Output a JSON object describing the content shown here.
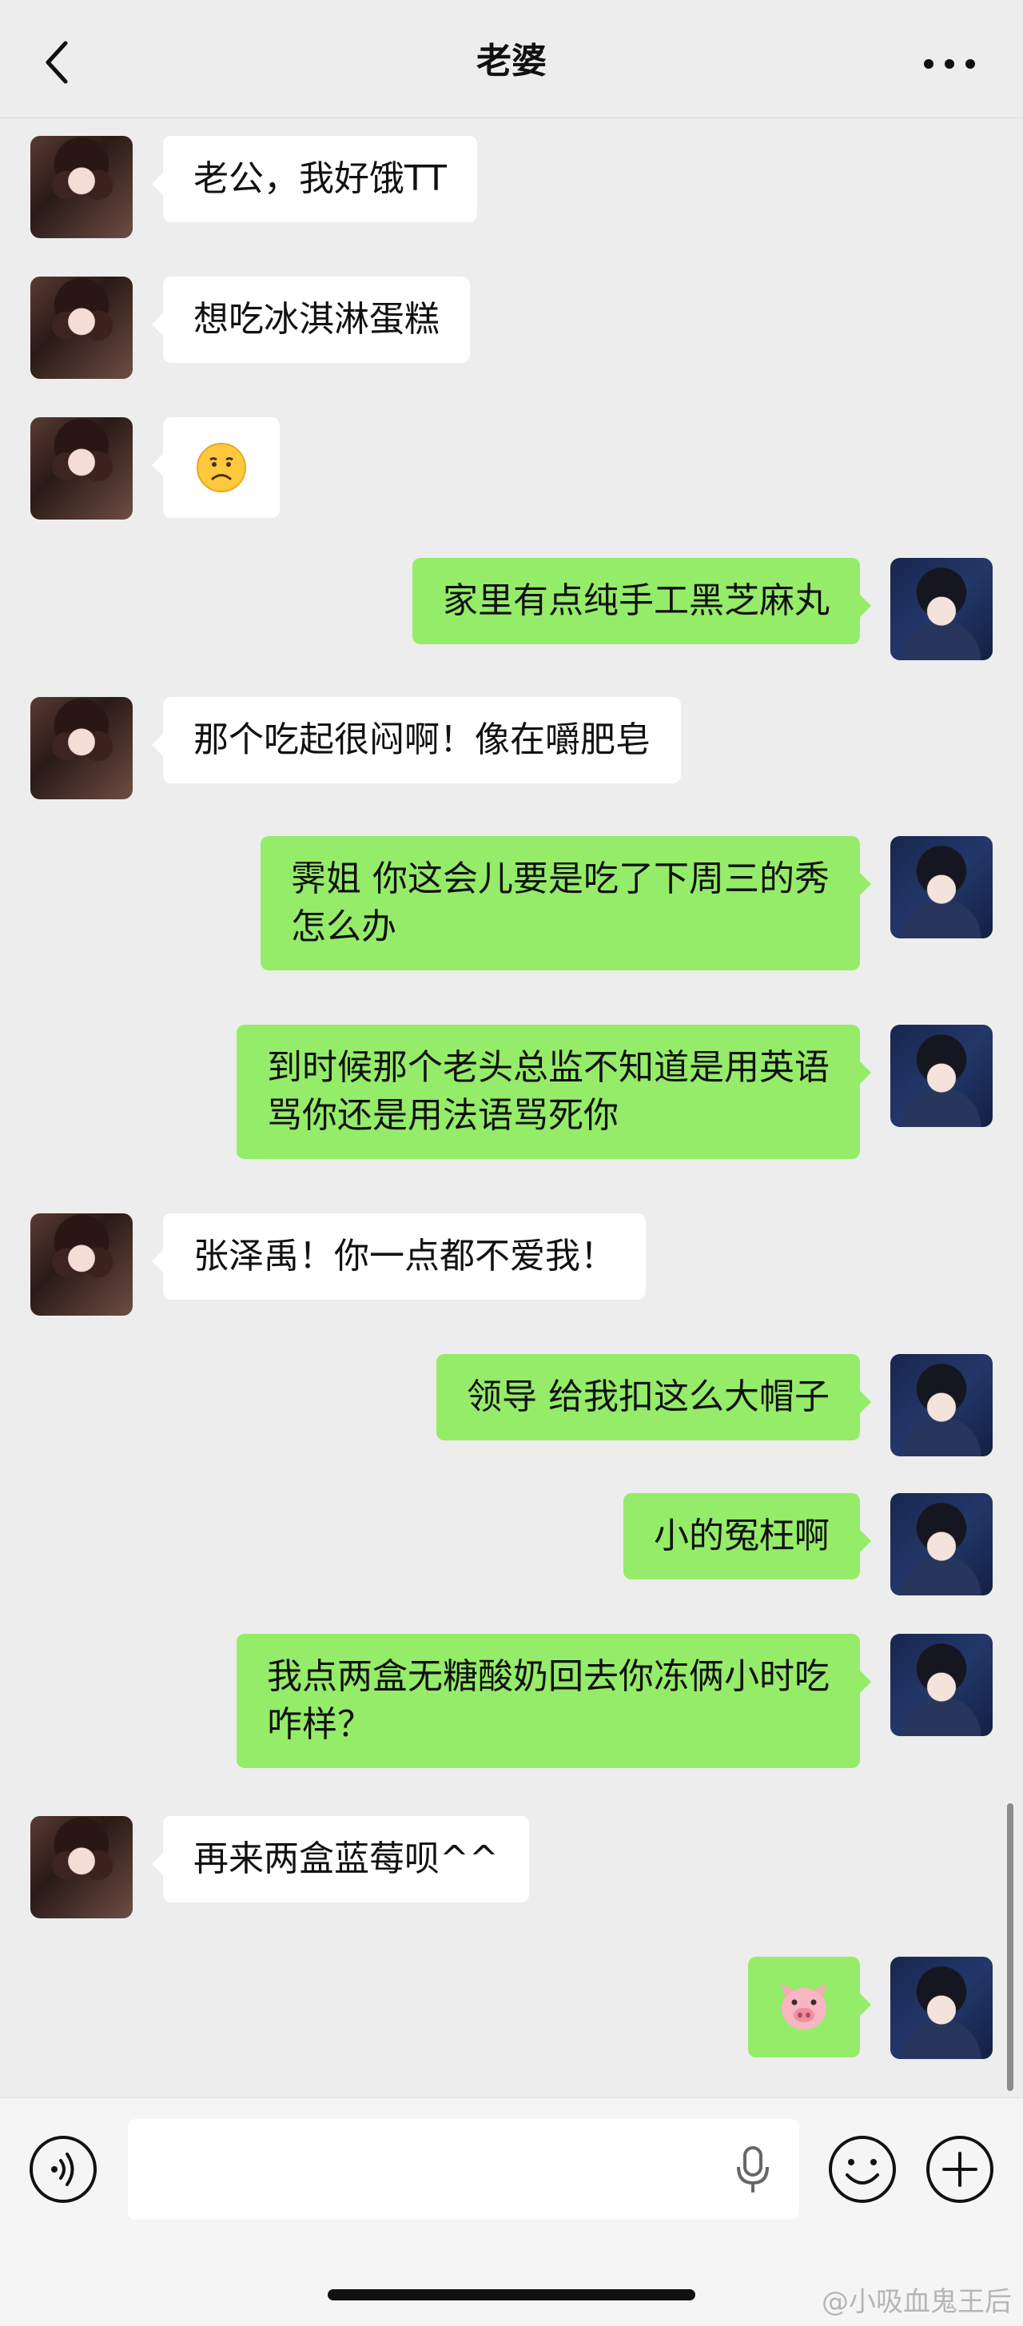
{
  "header": {
    "title": "老婆"
  },
  "messages": [
    {
      "side": "left",
      "text": "老公，我好饿TT"
    },
    {
      "side": "left",
      "text": "想吃冰淇淋蛋糕"
    },
    {
      "side": "left",
      "emoji": "sad-face"
    },
    {
      "side": "right",
      "text": "家里有点纯手工黑芝麻丸"
    },
    {
      "side": "left",
      "text": "那个吃起很闷啊！像在嚼肥皂"
    },
    {
      "side": "right",
      "text": "霁姐 你这会儿要是吃了下周三的秀\n怎么办"
    },
    {
      "side": "right",
      "text": "到时候那个老头总监不知道是用英语\n骂你还是用法语骂死你"
    },
    {
      "side": "left",
      "text": "张泽禹！你一点都不爱我！"
    },
    {
      "side": "right",
      "text": "领导 给我扣这么大帽子"
    },
    {
      "side": "right",
      "text": "小的冤枉啊"
    },
    {
      "side": "right",
      "text": "我点两盒无糖酸奶回去你冻俩小时吃\n咋样？"
    },
    {
      "side": "left",
      "text": "再来两盒蓝莓呗^^"
    },
    {
      "side": "right",
      "emoji": "pig-face"
    }
  ],
  "input": {
    "value": "",
    "placeholder": ""
  },
  "watermark": "@小吸血鬼王后",
  "colors": {
    "background": "#ededed",
    "self_bubble": "#95ec69",
    "other_bubble": "#ffffff"
  }
}
